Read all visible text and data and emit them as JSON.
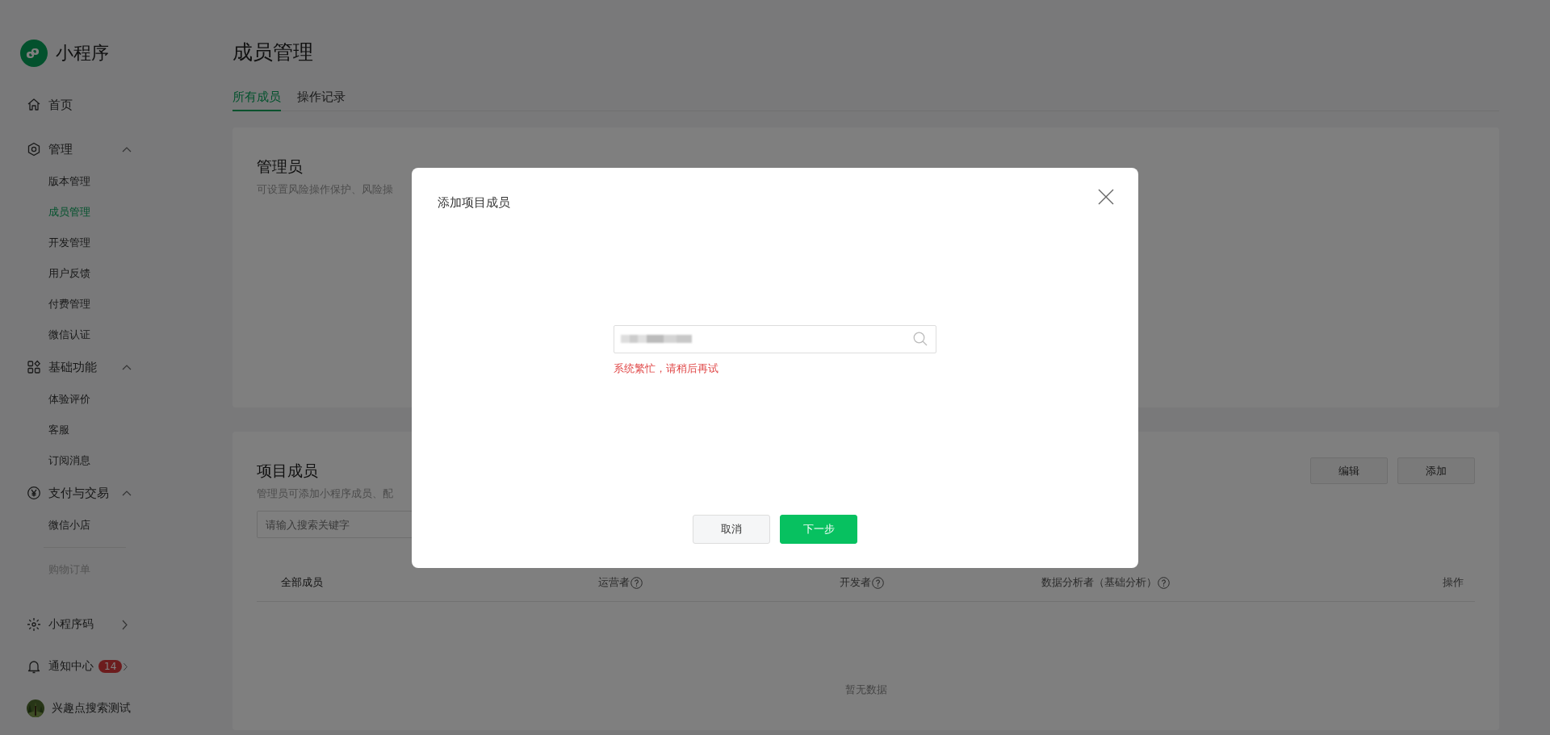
{
  "app": {
    "name": "小程序"
  },
  "sidebar": {
    "sections": [
      {
        "label": "首页",
        "selected": false
      },
      {
        "label": "管理",
        "expanded": true,
        "children": [
          {
            "label": "版本管理",
            "selected": false,
            "disabled": false
          },
          {
            "label": "成员管理",
            "selected": true,
            "disabled": false
          },
          {
            "label": "开发管理",
            "selected": false,
            "disabled": false
          },
          {
            "label": "用户反馈",
            "selected": false,
            "disabled": false
          },
          {
            "label": "付费管理",
            "selected": false,
            "disabled": false
          },
          {
            "label": "微信认证",
            "selected": false,
            "disabled": false
          }
        ]
      },
      {
        "label": "基础功能",
        "expanded": true,
        "children": [
          {
            "label": "体验评价",
            "selected": false,
            "disabled": false
          },
          {
            "label": "客服",
            "selected": false,
            "disabled": false
          },
          {
            "label": "订阅消息",
            "selected": false,
            "disabled": false
          }
        ]
      },
      {
        "label": "支付与交易",
        "expanded": true,
        "children": [
          {
            "label": "微信小店",
            "selected": false,
            "disabled": false
          },
          {
            "label": "购物订单",
            "selected": false,
            "disabled": true
          }
        ]
      }
    ],
    "footer": [
      {
        "kind": "link",
        "label": "小程序码"
      },
      {
        "kind": "link",
        "label": "通知中心",
        "badge": "14"
      },
      {
        "kind": "account",
        "label": "兴趣点搜索测试"
      }
    ]
  },
  "page": {
    "title": "成员管理",
    "tabs": [
      {
        "label": "所有成员",
        "selected": true
      },
      {
        "label": "操作记录",
        "selected": false
      }
    ],
    "admin_card": {
      "title": "管理员",
      "description": "可设置风险操作保护、风险操"
    },
    "members_card": {
      "title": "项目成员",
      "description": "管理员可添加小程序成员、配",
      "search": {
        "placeholder": "请输入搜索关键字"
      },
      "buttons": [
        "编辑",
        "添加"
      ],
      "table": {
        "columns": [
          {
            "label": "全部成员",
            "help": false
          },
          {
            "label": "运营者",
            "help": true
          },
          {
            "label": "开发者",
            "help": true
          },
          {
            "label": "数据分析者（基础分析）",
            "help": true
          },
          {
            "label": "操作",
            "help": false
          }
        ],
        "empty_text": "暂无数据"
      }
    }
  },
  "modal": {
    "title": "添加项目成员",
    "search": {
      "redacted": true
    },
    "error": "系统繁忙，请稍后再试",
    "buttons": [
      {
        "kind": "secondary",
        "label": "取消"
      },
      {
        "kind": "primary",
        "label": "下一步"
      }
    ]
  }
}
